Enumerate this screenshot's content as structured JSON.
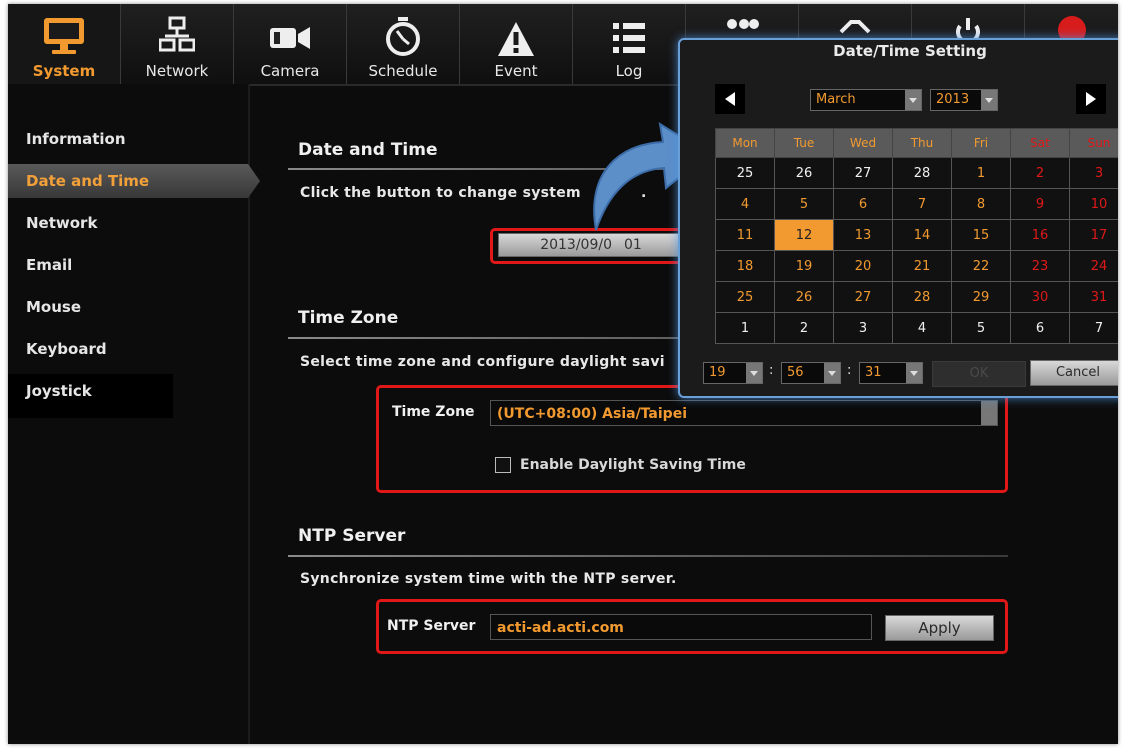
{
  "nav": {
    "tabs": [
      {
        "label": "System",
        "icon": "monitor-icon",
        "active": true
      },
      {
        "label": "Network",
        "icon": "network-icon",
        "active": false
      },
      {
        "label": "Camera",
        "icon": "camera-icon",
        "active": false
      },
      {
        "label": "Schedule",
        "icon": "stopwatch-icon",
        "active": false
      },
      {
        "label": "Event",
        "icon": "warning-icon",
        "active": false
      },
      {
        "label": "Log",
        "icon": "list-icon",
        "active": false
      },
      {
        "label": "",
        "icon": "users-icon",
        "active": false
      },
      {
        "label": "",
        "icon": "tools-icon",
        "active": false
      },
      {
        "label": "",
        "icon": "power-icon",
        "active": false
      }
    ]
  },
  "sidebar": {
    "items": [
      {
        "label": "Information"
      },
      {
        "label": "Date and Time",
        "active": true
      },
      {
        "label": "Network"
      },
      {
        "label": "Email"
      },
      {
        "label": "Mouse"
      },
      {
        "label": "Keyboard"
      },
      {
        "label": "Joystick"
      }
    ]
  },
  "date_time": {
    "title": "Date and Time",
    "desc": "Click the button to change system",
    "desc_tail": ".",
    "button_value": "2013/09/0",
    "button_value_tail": "01"
  },
  "time_zone": {
    "title": "Time Zone",
    "desc": "Select time zone and configure daylight savi",
    "field_label": "Time Zone",
    "field_value": "(UTC+08:00) Asia/Taipei",
    "dst_label": "Enable Daylight Saving Time",
    "dst_checked": false
  },
  "ntp": {
    "title": "NTP Server",
    "desc": "Synchronize system time with the NTP server.",
    "field_label": "NTP Server",
    "field_value": "acti-ad.acti.com",
    "apply_label": "Apply"
  },
  "dialog": {
    "title": "Date/Time Setting",
    "month": "March",
    "year": "2013",
    "weekdays": [
      "Mon",
      "Tue",
      "Wed",
      "Thu",
      "Fri",
      "Sat",
      "Sun"
    ],
    "weeks": [
      [
        {
          "d": "25",
          "t": "cur"
        },
        {
          "d": "26",
          "t": "cur"
        },
        {
          "d": "27",
          "t": "cur"
        },
        {
          "d": "28",
          "t": "cur"
        },
        {
          "d": "1",
          "t": "oth"
        },
        {
          "d": "2",
          "t": "we"
        },
        {
          "d": "3",
          "t": "we"
        }
      ],
      [
        {
          "d": "4",
          "t": "oth"
        },
        {
          "d": "5",
          "t": "oth"
        },
        {
          "d": "6",
          "t": "oth"
        },
        {
          "d": "7",
          "t": "oth"
        },
        {
          "d": "8",
          "t": "oth"
        },
        {
          "d": "9",
          "t": "we"
        },
        {
          "d": "10",
          "t": "we"
        }
      ],
      [
        {
          "d": "11",
          "t": "oth"
        },
        {
          "d": "12",
          "t": "sel"
        },
        {
          "d": "13",
          "t": "oth"
        },
        {
          "d": "14",
          "t": "oth"
        },
        {
          "d": "15",
          "t": "oth"
        },
        {
          "d": "16",
          "t": "we"
        },
        {
          "d": "17",
          "t": "we"
        }
      ],
      [
        {
          "d": "18",
          "t": "oth"
        },
        {
          "d": "19",
          "t": "oth"
        },
        {
          "d": "20",
          "t": "oth"
        },
        {
          "d": "21",
          "t": "oth"
        },
        {
          "d": "22",
          "t": "oth"
        },
        {
          "d": "23",
          "t": "we"
        },
        {
          "d": "24",
          "t": "we"
        }
      ],
      [
        {
          "d": "25",
          "t": "oth"
        },
        {
          "d": "26",
          "t": "oth"
        },
        {
          "d": "27",
          "t": "oth"
        },
        {
          "d": "28",
          "t": "oth"
        },
        {
          "d": "29",
          "t": "oth"
        },
        {
          "d": "30",
          "t": "we"
        },
        {
          "d": "31",
          "t": "we"
        }
      ],
      [
        {
          "d": "1",
          "t": "cur"
        },
        {
          "d": "2",
          "t": "cur"
        },
        {
          "d": "3",
          "t": "cur"
        },
        {
          "d": "4",
          "t": "cur"
        },
        {
          "d": "5",
          "t": "cur"
        },
        {
          "d": "6",
          "t": "cur"
        },
        {
          "d": "7",
          "t": "cur"
        }
      ]
    ],
    "hour": "19",
    "minute": "56",
    "second": "31",
    "time_sep": ":",
    "ok_label": "OK",
    "cancel_label": "Cancel"
  },
  "colors": {
    "accent": "#f29a30",
    "highlight_box": "#e01818",
    "dialog_glow": "#6aa0d8",
    "callout_arrow": "#5c8ec8"
  }
}
